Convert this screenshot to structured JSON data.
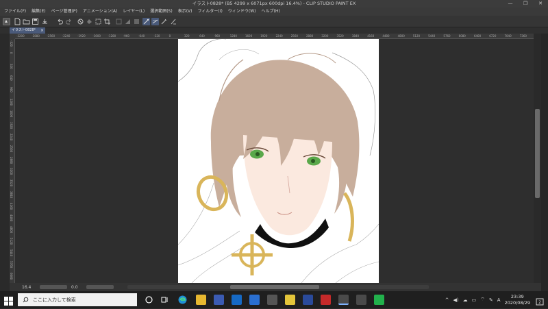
{
  "window": {
    "title": "イラスト0828* (B5 4299 x 6071px 600dpi 16.4%)  - CLIP STUDIO PAINT EX",
    "minimize": "—",
    "maximize": "❐",
    "close": "✕"
  },
  "menu": [
    "ファイル(F)",
    "編集(E)",
    "ページ管理(P)",
    "アニメーション(A)",
    "レイヤー(L)",
    "選択範囲(S)",
    "表示(V)",
    "フィルター(I)",
    "ウィンドウ(W)",
    "ヘルプ(H)"
  ],
  "document_tab": {
    "label": "イラスト0828*",
    "close": "×"
  },
  "ruler_top_labels": [
    "-3200",
    "-2880",
    "-2560",
    "-2240",
    "-1920",
    "-1600",
    "-1280",
    "-960",
    "-640",
    "-320",
    "0",
    "320",
    "640",
    "960",
    "1280",
    "1600",
    "1920",
    "2240",
    "2560",
    "2880",
    "3200",
    "3520",
    "3840",
    "4160",
    "4480",
    "4800",
    "5120",
    "5440",
    "5760",
    "6080",
    "6400",
    "6720",
    "7040",
    "7360"
  ],
  "ruler_left_labels": [
    "-320",
    "0",
    "320",
    "640",
    "960",
    "1280",
    "1600",
    "1920",
    "2240",
    "2560",
    "2880",
    "3200",
    "3520",
    "3840",
    "4160",
    "4480",
    "4800",
    "5120",
    "5440",
    "5760",
    "6080"
  ],
  "status": {
    "zoom": "16.4",
    "angle": "0.0"
  },
  "taskbar": {
    "search_placeholder": "ここに入力して検索",
    "time": "23:39",
    "date": "2020/08/29",
    "ime": "A",
    "notifications": "2"
  },
  "colors": {
    "accent_tab": "#4a5a7a",
    "hair": "#c8ae9c",
    "gold": "#d9b55a",
    "eye": "#5aa84a",
    "skin": "#fbe9df"
  }
}
